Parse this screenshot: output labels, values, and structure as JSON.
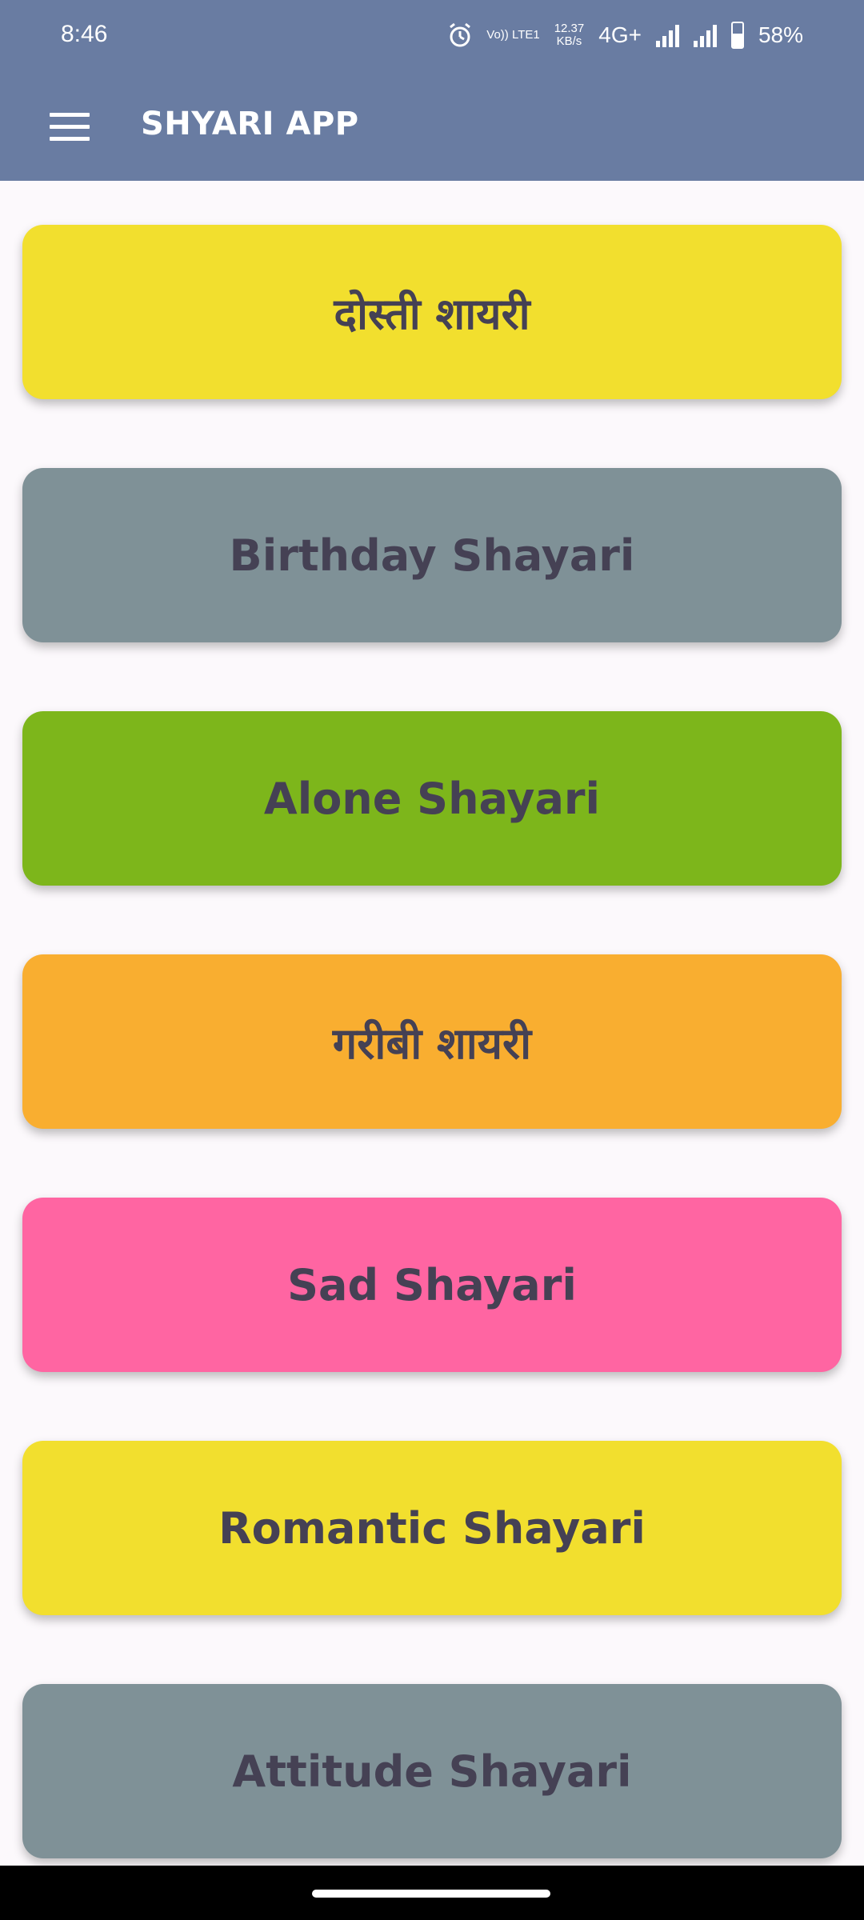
{
  "status_bar": {
    "time": "8:46",
    "volte": "Vo)) LTE1",
    "net_speed": "12.37",
    "net_speed_unit": "KB/s",
    "network": "4G+",
    "battery_percent": "58%",
    "battery_level": 0.58,
    "icons": [
      "alarm-icon",
      "signal-icon",
      "signal-icon",
      "battery-icon"
    ]
  },
  "app_bar": {
    "title": "SHYARI APP",
    "menu_icon": "menu-icon"
  },
  "categories": [
    {
      "label": "दोस्ती शायरी",
      "color": "#f2df2e"
    },
    {
      "label": "Birthday Shayari",
      "color": "#7f9197"
    },
    {
      "label": "Alone Shayari",
      "color": "#7db61b"
    },
    {
      "label": "गरीबी शायरी",
      "color": "#f9ae30"
    },
    {
      "label": "Sad Shayari",
      "color": "#ff65a2"
    },
    {
      "label": "Romantic Shayari",
      "color": "#f2df2e"
    },
    {
      "label": "Attitude Shayari",
      "color": "#7f9197"
    }
  ],
  "colors": {
    "app_bar": "#697ca2",
    "background": "#fcf9fc",
    "label_text": "#454154"
  }
}
